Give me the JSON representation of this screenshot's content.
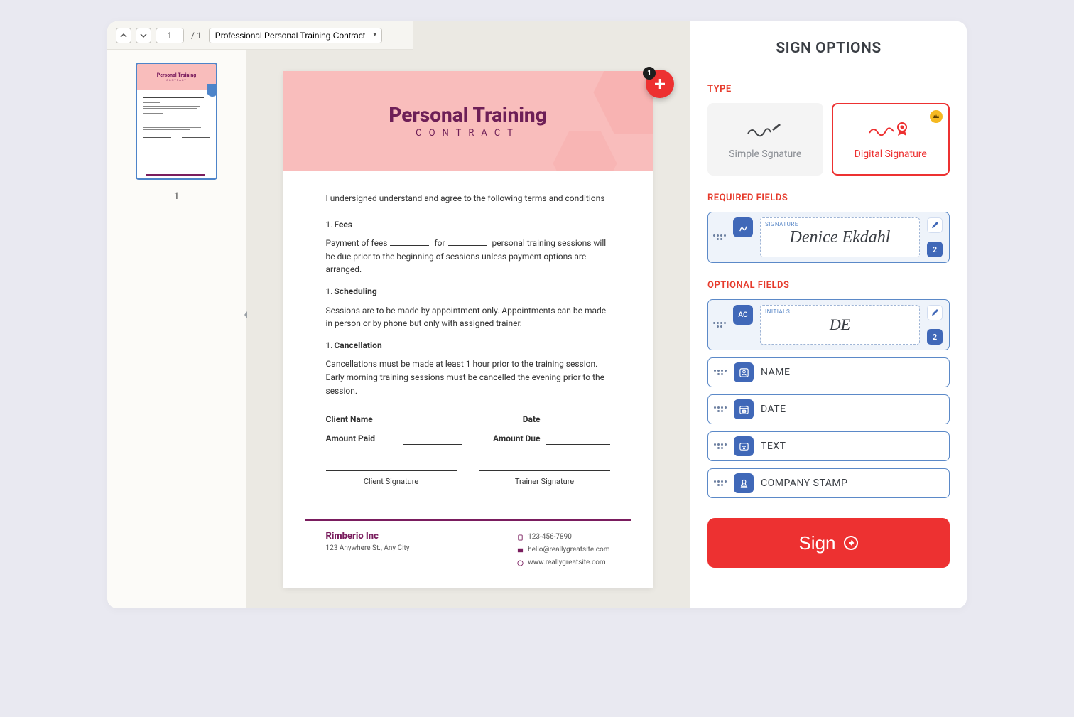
{
  "toolbar": {
    "current_page": "1",
    "total_pages": "1",
    "doc_name": "Professional Personal Training Contract"
  },
  "thumb": {
    "number": "1",
    "title": "Personal Training",
    "subtitle": "CONTRACT"
  },
  "document": {
    "title": "Personal Training",
    "subtitle": "CONTRACT",
    "intro": "I undersigned understand and agree to the following terms and conditions",
    "sections": {
      "fees": {
        "num": "1.",
        "title": "Fees",
        "body_a": "Payment of fees",
        "body_b": "for",
        "body_c": "personal training sessions will be due prior to the beginning of sessions unless payment options are arranged."
      },
      "scheduling": {
        "num": "1.",
        "title": "Scheduling",
        "body": "Sessions are to be made by appointment only. Appointments can be made in person or by phone but only with assigned trainer."
      },
      "cancellation": {
        "num": "1.",
        "title": "Cancellation",
        "body": "Cancellations must be made at least 1 hour prior to the training session. Early morning training sessions must be cancelled the evening prior to the session."
      }
    },
    "fields": {
      "client_name": "Client Name",
      "date": "Date",
      "amount_paid": "Amount Paid",
      "amount_due": "Amount Due",
      "client_sig": "Client Signature",
      "trainer_sig": "Trainer Signature"
    },
    "company": {
      "name": "Rimberio Inc",
      "address": "123 Anywhere St., Any City",
      "phone": "123-456-7890",
      "email": "hello@reallygreatsite.com",
      "web": "www.reallygreatsite.com"
    }
  },
  "fab": {
    "badge": "1"
  },
  "sidebar": {
    "title": "SIGN OPTIONS",
    "labels": {
      "type": "TYPE",
      "required": "REQUIRED FIELDS",
      "optional": "OPTIONAL FIELDS"
    },
    "types": {
      "simple": "Simple Sgnature",
      "digital": "Digital Signature"
    },
    "signature": {
      "tag": "SIGNATURE",
      "value": "Denice Ekdahl",
      "count": "2"
    },
    "initials": {
      "tag": "INITIALS",
      "badge": "AC",
      "value": "DE",
      "count": "2"
    },
    "fields": {
      "name": "NAME",
      "date": "DATE",
      "text": "TEXT",
      "stamp": "COMPANY STAMP"
    },
    "sign_button": "Sign"
  }
}
